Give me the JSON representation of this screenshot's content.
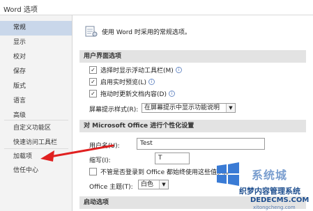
{
  "window": {
    "title": "Word 选项"
  },
  "sidebar": {
    "items": [
      {
        "label": "常规"
      },
      {
        "label": "显示"
      },
      {
        "label": "校对"
      },
      {
        "label": "保存"
      },
      {
        "label": "版式"
      },
      {
        "label": "语言"
      },
      {
        "label": "高级"
      },
      {
        "label": "自定义功能区"
      },
      {
        "label": "快速访问工具栏"
      },
      {
        "label": "加载项"
      },
      {
        "label": "信任中心"
      }
    ],
    "active_index": 0
  },
  "main": {
    "intro": "使用 Word 时采用的常规选项。",
    "ui_section": {
      "header": "用户界面选项",
      "checks": [
        {
          "label": "选择时显示浮动工具栏(M)",
          "checked": true,
          "info": true
        },
        {
          "label": "启用实时预览(L)",
          "checked": true,
          "info": true
        },
        {
          "label": "拖动时更新文档内容(D)",
          "checked": true,
          "info": true
        }
      ],
      "screentip": {
        "label": "屏幕提示样式(R):",
        "value": "在屏幕提示中显示功能说明"
      }
    },
    "personalize_section": {
      "header": "对 Microsoft Office 进行个性化设置",
      "username": {
        "label": "用户名(U):",
        "value": "Test"
      },
      "initials": {
        "label": "缩写(I):",
        "value": "T"
      },
      "always_use": {
        "label": "不管是否登录到 Office 都始终使用这些值(A)。",
        "checked": false
      },
      "theme": {
        "label": "Office 主题(T):",
        "value": "白色"
      }
    },
    "startup_section": {
      "header": "启动选项"
    }
  },
  "watermark": {
    "brand": "系统城",
    "line1": "织梦内容管理系统",
    "line2": "DEDECMS.COM",
    "line3": "xitongcheng.com"
  },
  "annotation": {
    "arrow_color": "#e02020"
  },
  "colors": {
    "sidebar_active": "#c9d7ea",
    "section_header": "#e3e3e3"
  }
}
